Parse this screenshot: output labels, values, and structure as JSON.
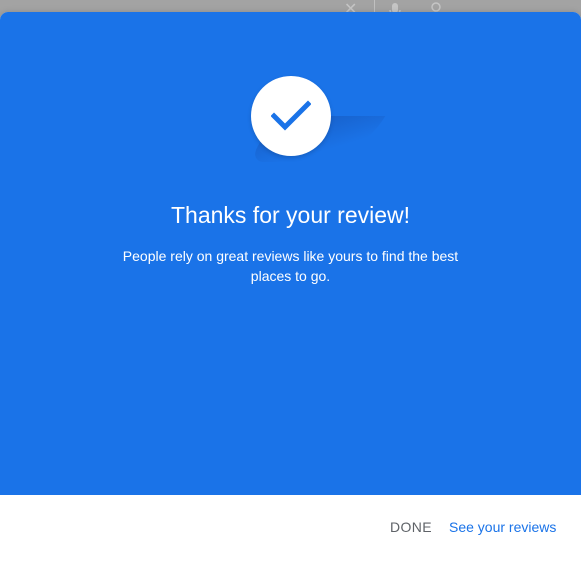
{
  "background": {
    "icons": [
      "close-icon",
      "mic-icon",
      "account-icon"
    ]
  },
  "dialog": {
    "title": "Thanks for your review!",
    "message": "People rely on great reviews like yours to find the best places to go.",
    "icon": "checkmark-icon",
    "colors": {
      "hero": "#1a73e8",
      "check": "#1a73e8",
      "done_text": "#5f6368",
      "link_text": "#1a73e8"
    },
    "buttons": {
      "done_label": "DONE",
      "see_reviews_label": "See your reviews"
    }
  }
}
